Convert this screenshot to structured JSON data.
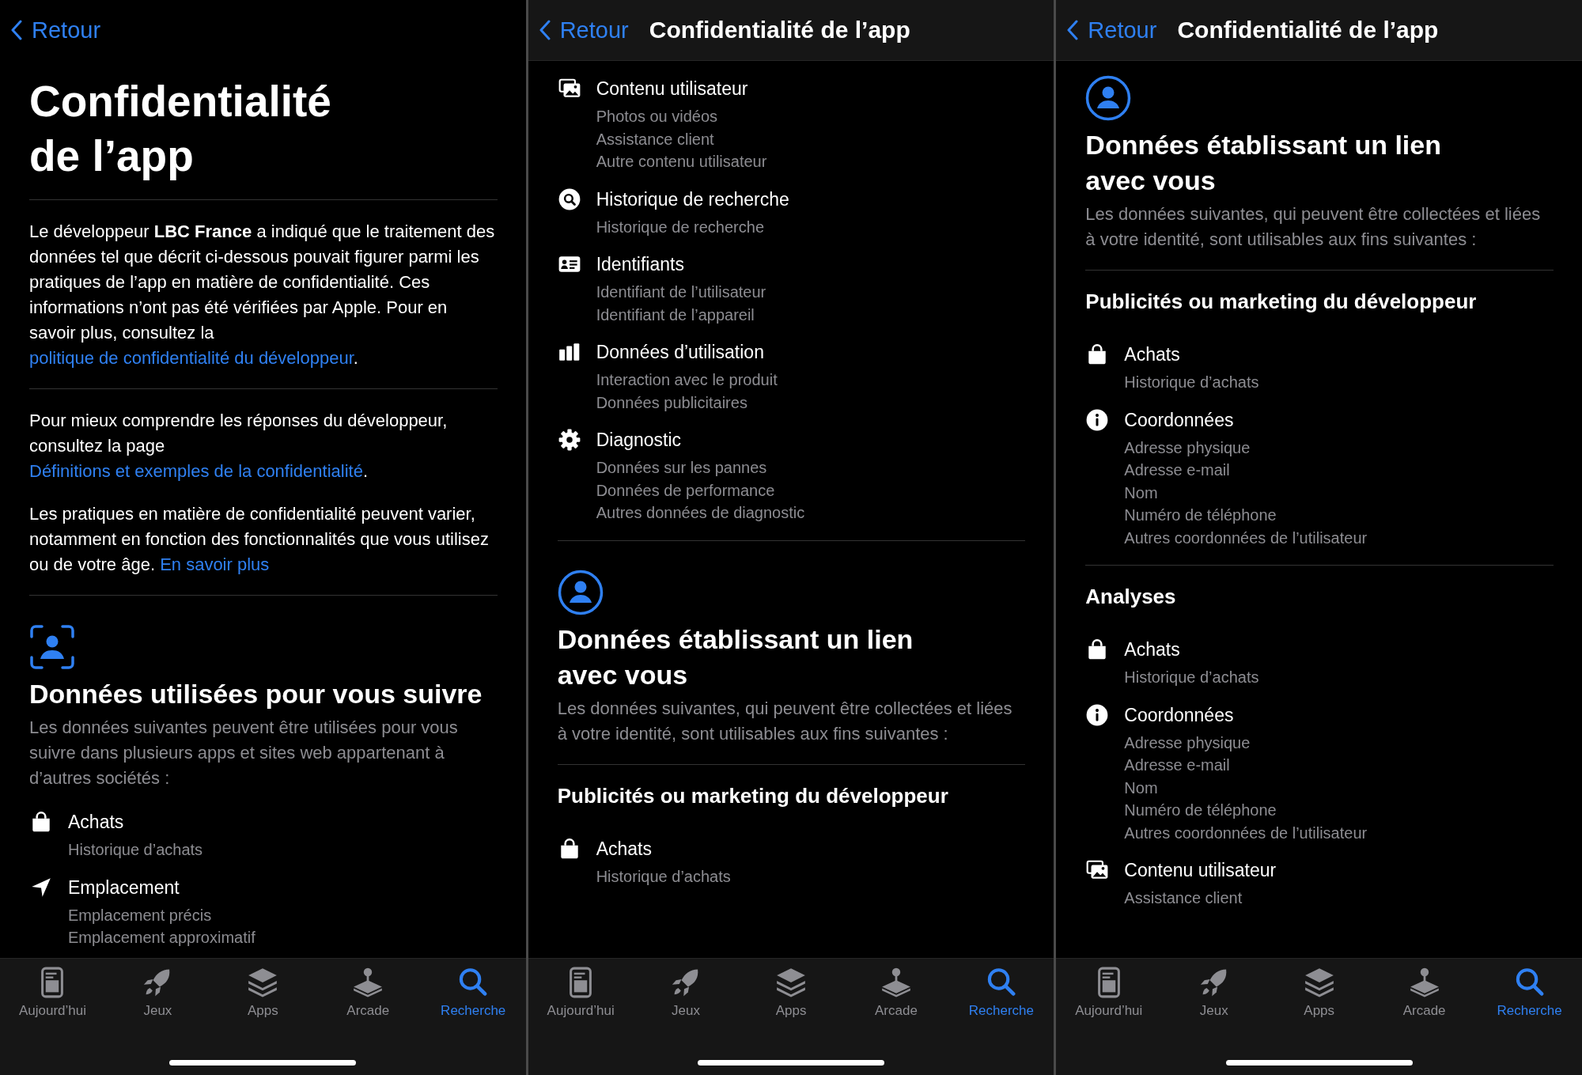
{
  "panels": [
    {
      "nav": {
        "back": "Retour"
      },
      "blocks": [
        {
          "kind": "title",
          "lines": [
            "Confidentialité",
            "de l’app"
          ]
        },
        {
          "kind": "divider"
        },
        {
          "kind": "paragraph",
          "segments": [
            {
              "kind": "text",
              "text": "Le développeur **LBC France** a indiqué que le traitement des données tel que décrit ci-dessous pouvait figurer parmi les pratiques de l’app en matière de confidentialité. Ces informations n’ont pas été vérifiées par Apple. Pour en savoir plus, consultez la "
            },
            {
              "kind": "link",
              "text": "politique de confidentialité du développeur"
            },
            {
              "kind": "text",
              "text": "."
            }
          ]
        },
        {
          "kind": "divider"
        },
        {
          "kind": "paragraph",
          "segments": [
            {
              "kind": "text",
              "text": "Pour mieux comprendre les réponses du développeur, consultez la page "
            },
            {
              "kind": "link",
              "text": "Définitions et exemples de la confidentialité"
            },
            {
              "kind": "text",
              "text": "."
            }
          ]
        },
        {
          "kind": "paragraph",
          "segments": [
            {
              "kind": "text",
              "text": "Les pratiques en matière de confidentialité peuvent varier, notamment en fonction des fonctionnalités que vous utilisez ou de votre âge. "
            },
            {
              "kind": "link",
              "text": "En savoir plus"
            }
          ]
        },
        {
          "kind": "divider"
        },
        {
          "kind": "tracking"
        },
        {
          "kind": "section_title",
          "lines": [
            "Données utilisées pour vous suivre"
          ]
        },
        {
          "kind": "section_desc",
          "text": "Les données suivantes peuvent être utilisées pour vous suivre dans plusieurs apps et sites web appartenant à d’autres sociétés :"
        },
        {
          "kind": "purchases",
          "name": "Achats",
          "items": [
            "Historique d’achats"
          ]
        },
        {
          "kind": "location",
          "name": "Emplacement",
          "items": [
            "Emplacement précis",
            "Emplacement approximatif"
          ]
        }
      ],
      "tab_bar": [
        {
          "label": "Aujourd’hui",
          "selected": false
        },
        {
          "label": "Jeux",
          "selected": false
        },
        {
          "label": "Apps",
          "selected": false
        },
        {
          "label": "Arcade",
          "selected": false
        },
        {
          "label": "Recherche",
          "selected": true
        }
      ]
    },
    {
      "nav": {
        "back": "Retour",
        "title": "Confidentialité de l’app"
      },
      "blocks": [
        {
          "kind": "content",
          "name": "Contenu utilisateur",
          "items": [
            "Photos ou vidéos",
            "Assistance client",
            "Autre contenu utilisateur"
          ]
        },
        {
          "kind": "searches",
          "name": "Historique de recherche",
          "items": [
            "Historique de recherche"
          ]
        },
        {
          "kind": "identifiers",
          "name": "Identifiants",
          "items": [
            "Identifiant de l’utilisateur",
            "Identifiant de l’appareil"
          ]
        },
        {
          "kind": "usage",
          "name": "Données d’utilisation",
          "items": [
            "Interaction avec le produit",
            "Données publicitaires"
          ]
        },
        {
          "kind": "diagnostics",
          "name": "Diagnostic",
          "items": [
            "Données sur les pannes",
            "Données de performance",
            "Autres données de diagnostic"
          ]
        },
        {
          "kind": "divider"
        },
        {
          "kind": "linked"
        },
        {
          "kind": "section_title",
          "lines": [
            "Données établissant un lien",
            "avec vous"
          ]
        },
        {
          "kind": "section_desc",
          "text": "Les données suivantes, qui peuvent être collectées et liées à votre identité, sont utilisables aux fins suivantes :"
        },
        {
          "kind": "divider"
        },
        {
          "kind": "subheading",
          "text": "Publicités ou marketing du développeur"
        },
        {
          "kind": "purchases",
          "name": "Achats",
          "items": [
            "Historique d’achats"
          ]
        }
      ],
      "tab_bar": [
        {
          "label": "Aujourd’hui",
          "selected": false
        },
        {
          "label": "Jeux",
          "selected": false
        },
        {
          "label": "Apps",
          "selected": false
        },
        {
          "label": "Arcade",
          "selected": false
        },
        {
          "label": "Recherche",
          "selected": true
        }
      ]
    },
    {
      "nav": {
        "back": "Retour",
        "title": "Confidentialité de l’app"
      },
      "blocks": [
        {
          "kind": "linked"
        },
        {
          "kind": "section_title",
          "lines": [
            "Données établissant un lien",
            "avec vous"
          ]
        },
        {
          "kind": "section_desc",
          "text": "Les données suivantes, qui peuvent être collectées et liées à votre identité, sont utilisables aux fins suivantes :"
        },
        {
          "kind": "divider"
        },
        {
          "kind": "subheading",
          "text": "Publicités ou marketing du développeur"
        },
        {
          "kind": "purchases",
          "name": "Achats",
          "items": [
            "Historique d’achats"
          ]
        },
        {
          "kind": "contact",
          "name": "Coordonnées",
          "items": [
            "Adresse physique",
            "Adresse e-mail",
            "Nom",
            "Numéro de téléphone",
            "Autres coordonnées de l’utilisateur"
          ]
        },
        {
          "kind": "divider"
        },
        {
          "kind": "subheading",
          "text": "Analyses"
        },
        {
          "kind": "purchases",
          "name": "Achats",
          "items": [
            "Historique d’achats"
          ]
        },
        {
          "kind": "contact",
          "name": "Coordonnées",
          "items": [
            "Adresse physique",
            "Adresse e-mail",
            "Nom",
            "Numéro de téléphone",
            "Autres coordonnées de l’utilisateur"
          ]
        },
        {
          "kind": "content",
          "name": "Contenu utilisateur",
          "items": [
            "Assistance client"
          ]
        }
      ],
      "tab_bar": [
        {
          "label": "Aujourd’hui",
          "selected": false
        },
        {
          "label": "Jeux",
          "selected": false
        },
        {
          "label": "Apps",
          "selected": false
        },
        {
          "label": "Arcade",
          "selected": false
        },
        {
          "label": "Recherche",
          "selected": true
        }
      ]
    }
  ]
}
